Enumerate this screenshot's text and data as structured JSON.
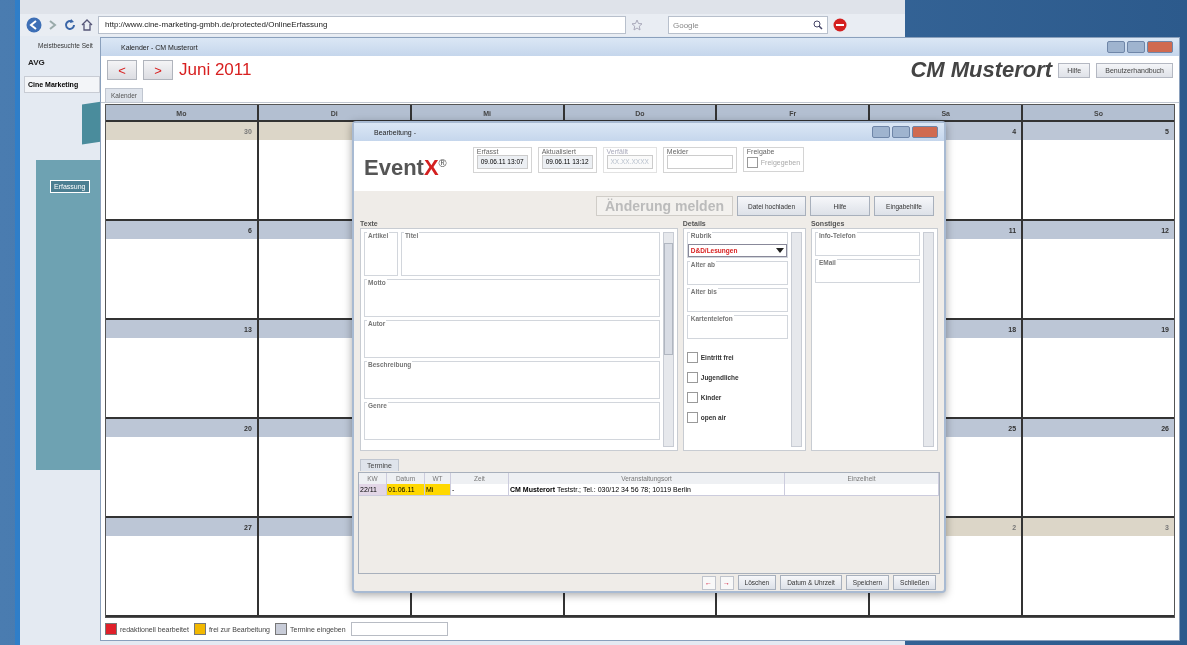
{
  "browser": {
    "url": "http://www.cine-marketing-gmbh.de/protected/OnlineErfassung",
    "search_placeholder": "Google",
    "bookmarks": "Meistbesuchte Seit",
    "toolbar_brand": "AVG",
    "tab": "Cine Marketing",
    "page_button": "Erfassung"
  },
  "calendar_window": {
    "title": "Kalender - CM Musterort",
    "nav": [
      "<",
      ">"
    ],
    "month": "Juni 2011",
    "brand": "CM Musterort",
    "buttons": [
      "Hilfe",
      "Benutzerhandbuch"
    ],
    "tab": "Kalender",
    "weekdays": [
      "Mo",
      "Di",
      "Mi",
      "Do",
      "Fr",
      "Sa",
      "So"
    ],
    "weeks": [
      {
        "cells": [
          {
            "day": "30",
            "other_month": true
          },
          {
            "other_month": true
          },
          null,
          null,
          null,
          {
            "day": "4",
            "other_month": false
          },
          {
            "day": "5",
            "other_month": false
          }
        ]
      },
      {
        "cells": [
          {
            "day": "6",
            "other_month": false
          },
          {
            "other_month": false
          },
          null,
          null,
          null,
          {
            "day": "11",
            "other_month": false
          },
          {
            "day": "12",
            "other_month": false
          }
        ]
      },
      {
        "cells": [
          {
            "day": "13",
            "other_month": false
          },
          {
            "other_month": false
          },
          null,
          null,
          null,
          {
            "day": "18",
            "other_month": false
          },
          {
            "day": "19",
            "other_month": false
          }
        ]
      },
      {
        "cells": [
          {
            "day": "20",
            "other_month": false
          },
          {
            "other_month": false
          },
          null,
          null,
          null,
          {
            "day": "25",
            "other_month": false
          },
          {
            "day": "26",
            "other_month": false
          }
        ]
      },
      {
        "cells": [
          {
            "day": "27",
            "other_month": false
          },
          {
            "other_month": false
          },
          null,
          null,
          null,
          {
            "day": "2",
            "other_month": true
          },
          {
            "day": "3",
            "other_month": true
          }
        ]
      }
    ],
    "legend": [
      {
        "label": "redaktionell bearbeitet",
        "color": "#e0202a"
      },
      {
        "label": "frei zur Bearbeitung",
        "color": "#f2b800"
      },
      {
        "label": "Termine eingeben",
        "color": "#c8ccd8"
      }
    ]
  },
  "dialog": {
    "title": "Bearbeitung -",
    "logo": {
      "text": "Event",
      "accent": "X",
      "mark": "®"
    },
    "header_fields": [
      {
        "label": "Erfasst",
        "value": "09.06.11 13:07",
        "disabled": false
      },
      {
        "label": "Aktualisiert",
        "value": "09.06.11 13:12",
        "disabled": false
      },
      {
        "label": "Verfällt",
        "placeholder": "XX.XX.XXXX",
        "disabled": true
      },
      {
        "label": "Melder",
        "disabled": false
      }
    ],
    "release": {
      "label": "Freigabe",
      "checkbox": "Freigegeben",
      "checked": false,
      "disabled": true
    },
    "actions": [
      {
        "label": "Änderung melden",
        "kind": "primary",
        "disabled": true
      },
      {
        "label": "Datei hochladen",
        "kind": "normal",
        "disabled": false
      },
      {
        "label": "Hilfe",
        "kind": "normal",
        "disabled": false
      },
      {
        "label": "Eingabehilfe",
        "kind": "normal",
        "disabled": false
      }
    ],
    "texte": {
      "title": "Texte",
      "fields": [
        "Artikel",
        "Titel",
        "Motto",
        "Autor",
        "Beschreibung",
        "Genre"
      ]
    },
    "details": {
      "title": "Details",
      "rubrik": {
        "label": "Rubrik",
        "value": "D&D/Lesungen"
      },
      "fields": [
        "Alter ab",
        "Alter bis",
        "Kartentelefon"
      ],
      "checks": [
        {
          "label": "Eintritt frei",
          "checked": false
        },
        {
          "label": "Jugendliche",
          "checked": false
        },
        {
          "label": "Kinder",
          "checked": false
        },
        {
          "label": "open air",
          "checked": false
        }
      ]
    },
    "sonstiges": {
      "title": "Sonstiges",
      "fields": [
        "Info-Telefon",
        "EMail"
      ]
    },
    "tab": "Termine",
    "table": {
      "columns": [
        "KW",
        "Datum",
        "WT",
        "Zeit",
        "Veranstaltungsort",
        "Einzelheit"
      ],
      "rows": [
        {
          "color": "#ffd800",
          "cells": [
            "22/11",
            "01.06.11",
            "Mi",
            "-",
            "**CM Musterort** Teststr.; Tel.: 030/12 34 56 78; 10119 Berlin",
            ""
          ]
        }
      ]
    },
    "nav": [
      "←",
      "→"
    ],
    "buttons": [
      "Löschen",
      "Datum & Uhrzeit",
      "Speichern",
      "Schließen"
    ]
  }
}
